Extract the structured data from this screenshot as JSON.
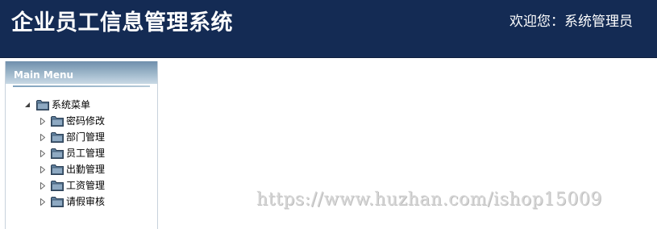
{
  "header": {
    "title": "企业员工信息管理系统",
    "welcome": "欢迎您：系统管理员",
    "background": "#142b54"
  },
  "sidebar": {
    "title": "Main Menu",
    "tree": {
      "root": {
        "label": "系统菜单",
        "expanded": true,
        "icon": "folder-icon"
      },
      "items": [
        {
          "label": "密码修改",
          "icon": "folder-icon"
        },
        {
          "label": "部门管理",
          "icon": "folder-icon"
        },
        {
          "label": "员工管理",
          "icon": "folder-icon"
        },
        {
          "label": "出勤管理",
          "icon": "folder-icon"
        },
        {
          "label": "工资管理",
          "icon": "folder-icon"
        },
        {
          "label": "请假审核",
          "icon": "folder-icon"
        }
      ]
    }
  },
  "watermark": "https://www.huzhan.com/ishop15009"
}
